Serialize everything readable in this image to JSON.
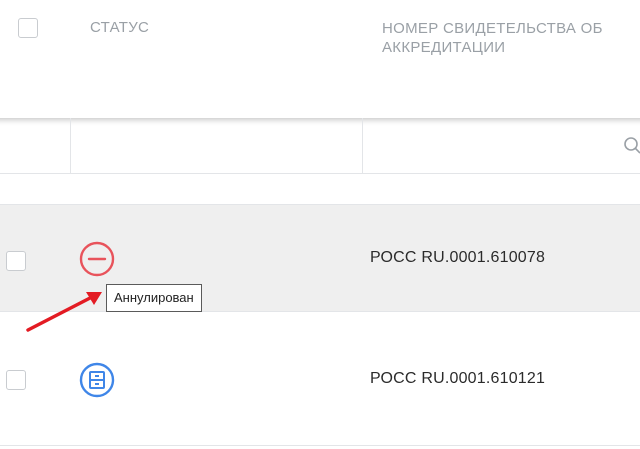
{
  "table": {
    "columns": {
      "status": "Статус",
      "number": "Номер свидетельства об аккредитации"
    },
    "rows": [
      {
        "status": "cancelled",
        "number": "РОСС RU.0001.610078"
      },
      {
        "status": "archived",
        "number": "РОСС RU.0001.610121"
      }
    ]
  },
  "tooltip": {
    "text": "Аннулирован"
  },
  "icons": {
    "status_cancelled": "minus-circle-icon",
    "status_archived": "archive-icon",
    "search": "search-icon",
    "annotation": "red-arrow-icon"
  },
  "colors": {
    "cancelled": "#e8535b",
    "archived": "#3f86e8",
    "arrow": "#e31b23",
    "header_text": "#9aa0a6",
    "row_highlight": "#efefef"
  }
}
